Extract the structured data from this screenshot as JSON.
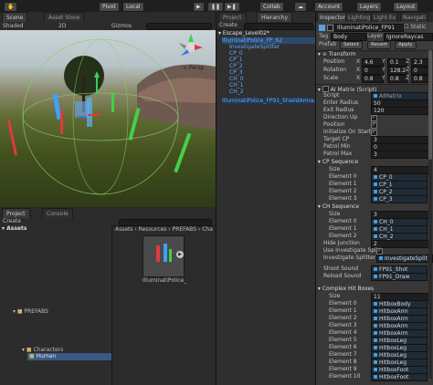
{
  "scene_panel": {
    "tabs": [
      "Scene",
      "Asset Store"
    ],
    "shading": "Shaded",
    "mode_2d": "2D",
    "gizmos": "Gizmos",
    "persp": "< Persp"
  },
  "toolbar": {
    "pivot": "Pivot",
    "local": "Local",
    "collab": "Collab",
    "account": "Account",
    "layers": "Layers",
    "layout": "Layout"
  },
  "project_panel": {
    "tabs": [
      "Project",
      "Console"
    ],
    "create": "Create",
    "tree_root": "Assets",
    "tree": [
      {
        "label": "PREFABS"
      },
      {
        "label": "Characters"
      },
      {
        "label": "Human"
      }
    ],
    "breadcrumb": "Assets › Resources › PREFABS › Cha",
    "asset_label": "IlluminatiPolice_"
  },
  "hierarchy": {
    "tab": "Hierarchy",
    "create": "Create",
    "scene": "Escape_Level02*",
    "items": [
      {
        "label": "IlluminatiPolice_FP_62",
        "indent": 1
      },
      {
        "label": "InvestigateSplitter",
        "indent": 2
      },
      {
        "label": "CP_0",
        "indent": 2
      },
      {
        "label": "CP_1",
        "indent": 2
      },
      {
        "label": "CP_2",
        "indent": 2
      },
      {
        "label": "CP_3",
        "indent": 2
      },
      {
        "label": "CH_0",
        "indent": 2
      },
      {
        "label": "CH_1",
        "indent": 2
      },
      {
        "label": "CH_2",
        "indent": 2
      },
      {
        "label": "IlluminatiPolice_FP91_ShieldArma...",
        "indent": 1
      }
    ]
  },
  "inspector": {
    "tabs": [
      "Inspector",
      "Lighting",
      "Light Ex",
      "Navigati"
    ],
    "object_name": "IlluminatiPolice_FP91",
    "static": "Static",
    "tag_label": "Tag",
    "tag_value": "Body",
    "layer_label": "Layer",
    "layer_value": "IgnoreRaycas",
    "prefab_label": "Prefab",
    "prefab_buttons": [
      "Select",
      "Revert",
      "Apply"
    ],
    "transform": {
      "title": "Transform",
      "rows": [
        {
          "label": "Position",
          "x": "4.6",
          "y": "0.1",
          "z": "2.3"
        },
        {
          "label": "Rotation",
          "x": "0",
          "y": "128.2",
          "z": "0"
        },
        {
          "label": "Scale",
          "x": "0.8",
          "y": "0.8",
          "z": "0.8"
        }
      ]
    },
    "ai_matrix": {
      "title": "AI Matrix (Script)",
      "script_label": "Script",
      "script_value": "AIMatrix",
      "fields": [
        {
          "label": "Enter Radius",
          "value": "50"
        },
        {
          "label": "Exit Radius",
          "value": "120"
        }
      ],
      "checks": [
        {
          "label": "Direction Up",
          "checked": true
        },
        {
          "label": "Position",
          "checked": true
        },
        {
          "label": "Initialize On Start",
          "checked": true
        }
      ],
      "fields2": [
        {
          "label": "Target CP",
          "value": "3"
        },
        {
          "label": "Patrol Min",
          "value": "0"
        },
        {
          "label": "Patrol Max",
          "value": "3"
        }
      ]
    },
    "cp_sequence": {
      "title": "CP Sequence",
      "size": "4",
      "elements": [
        {
          "label": "Element 0",
          "value": "CP_0"
        },
        {
          "label": "Element 1",
          "value": "CP_1"
        },
        {
          "label": "Element 2",
          "value": "CP_2"
        },
        {
          "label": "Element 3",
          "value": "CP_3"
        }
      ]
    },
    "ch_sequence": {
      "title": "CH Sequence",
      "size": "3",
      "elements": [
        {
          "label": "Element 0",
          "value": "CH_0"
        },
        {
          "label": "Element 1",
          "value": "CH_1"
        },
        {
          "label": "Element 2",
          "value": "CH_2"
        }
      ],
      "hide_junction_label": "Hide Junction",
      "hide_junction": "2",
      "use_splitter_label": "Use Investigate Splitt",
      "splitter_label": "Investigate Splitter",
      "splitter_value": "InvestigateSplit"
    },
    "sounds": [
      {
        "label": "Shoot Sound",
        "value": "FP91_Shot"
      },
      {
        "label": "Reload Sound",
        "value": "FP91_Draw"
      }
    ],
    "hit_boxes": {
      "title": "Complex Hit Boxes",
      "size": "11",
      "elements": [
        {
          "label": "Element 0",
          "value": "HitboxBody"
        },
        {
          "label": "Element 1",
          "value": "HitboxArm"
        },
        {
          "label": "Element 2",
          "value": "HitboxArm"
        },
        {
          "label": "Element 3",
          "value": "HitboxArm"
        },
        {
          "label": "Element 4",
          "value": "HitboxArm"
        },
        {
          "label": "Element 5",
          "value": "HitboxLeg"
        },
        {
          "label": "Element 6",
          "value": "HitboxLeg"
        },
        {
          "label": "Element 7",
          "value": "HitboxLeg"
        },
        {
          "label": "Element 8",
          "value": "HitboxLeg"
        },
        {
          "label": "Element 9",
          "value": "HitboxFoot"
        },
        {
          "label": "Element 10",
          "value": "HitboxFoot"
        }
      ]
    }
  }
}
